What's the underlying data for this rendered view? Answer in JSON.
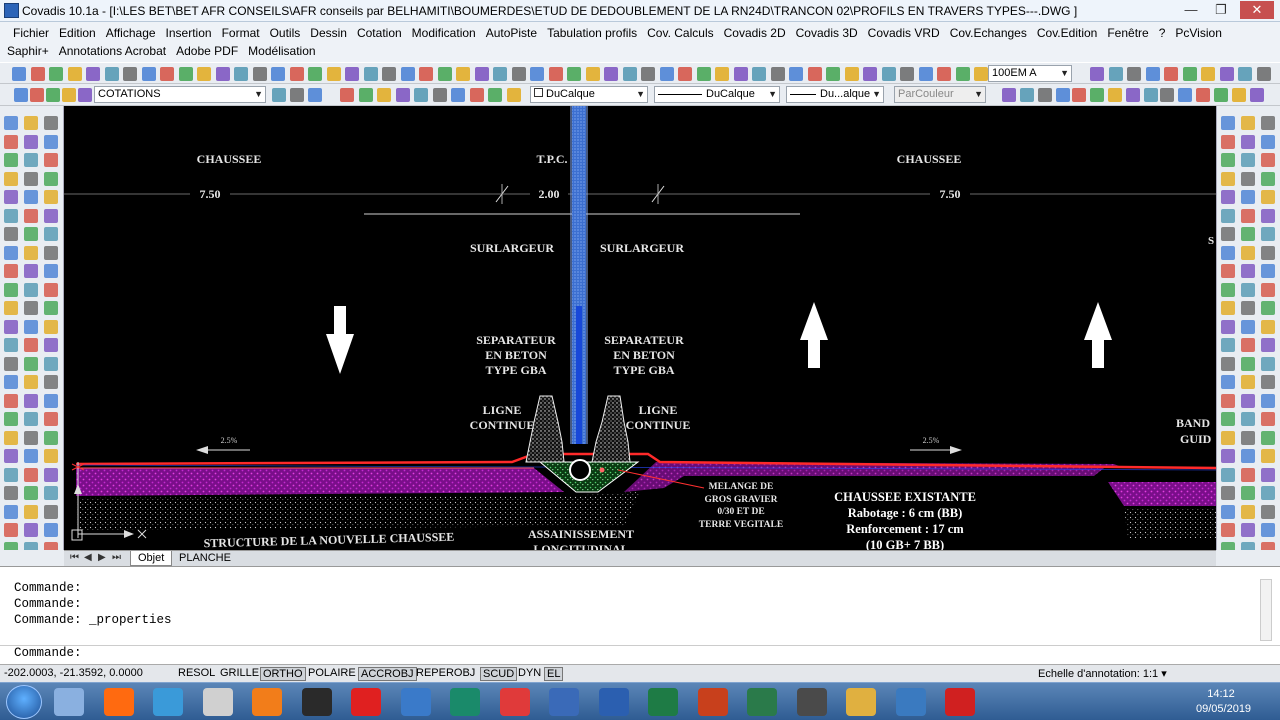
{
  "window": {
    "title": "Covadis 10.1a - [I:\\LES BET\\BET AFR CONSEILS\\AFR conseils par BELHAMITI\\BOUMERDES\\ETUD DE DEDOUBLEMENT DE LA RN24D\\TRANCON 02\\PROFILS EN TRAVERS TYPES---.DWG ]",
    "minimize": "—",
    "restore": "❐",
    "close": "✕"
  },
  "menu": {
    "row1": [
      "Fichier",
      "Edition",
      "Affichage",
      "Insertion",
      "Format",
      "Outils",
      "Dessin",
      "Cotation",
      "Modification",
      "AutoPiste",
      "Tabulation profils",
      "Cov. Calculs",
      "Covadis 2D",
      "Covadis 3D",
      "Covadis VRD",
      "Cov.Echanges",
      "Cov.Edition",
      "Fenêtre",
      "?",
      "PcVision"
    ],
    "row2": [
      "Saphir+",
      "Annotations Acrobat",
      "Adobe PDF",
      "Modélisation"
    ]
  },
  "toolbar": {
    "scale_value": "100EM A",
    "layer_value": "COTATIONS",
    "color_value": "DuCalque",
    "linetype_value": "DuCalque",
    "lineweight_value": "Du...alque",
    "plotstyle_value": "ParCouleur"
  },
  "drawing": {
    "label_chaussee_left": "CHAUSSEE",
    "label_tpc": "T.P.C.",
    "label_chaussee_right": "CHAUSSEE",
    "dim_left": "7.50",
    "dim_center": "2.00",
    "dim_right": "7.50",
    "surlargeur_left": "SURLARGEUR",
    "surlargeur_right": "SURLARGEUR",
    "separateur_left": "SEPARATEUR\nEN BETON\nTYPE GBA",
    "separateur_right": "SEPARATEUR\nEN BETON\nTYPE GBA",
    "ligne_left": "LIGNE\nCONTINUE",
    "ligne_right": "LIGNE\nCONTINUE",
    "slope_left": "2.5%",
    "slope_right": "2.5%",
    "melange": "MELANGE DE\nGROS GRAVIER\n0/30 ET DE\nTERRE VEGITALE",
    "chaussee_existante": "CHAUSSEE EXISTANTE\nRabotage : 6 cm (BB)\nRenforcement : 17 cm\n(10 GB+ 7 BB)",
    "structure": "STRUCTURE DE LA NOUVELLE CHAUSSEE",
    "assainissement": "ASSAINISSEMENT\nLONGITUDINAL",
    "edge_label_1": "BAND",
    "edge_label_2": "GUID",
    "edge_label_3": "S"
  },
  "layout_tabs": {
    "tabs": [
      "Objet",
      "PLANCHE"
    ]
  },
  "command": {
    "lines": [
      "Commande:",
      "Commande:",
      "Commande: _properties"
    ],
    "prompt": "Commande:"
  },
  "status": {
    "coords": "-202.0003, -21.3592, 0.0000",
    "buttons": [
      "RESOL",
      "GRILLE",
      "ORTHO",
      "POLAIRE",
      "ACCROBJ",
      "REPEROBJ",
      "SCUD",
      "DYN",
      "EL"
    ],
    "annotation_label": "Echelle d'annotation:",
    "annotation_value": "1:1"
  },
  "taskbar": {
    "time": "14:12",
    "date": "09/05/2019"
  }
}
